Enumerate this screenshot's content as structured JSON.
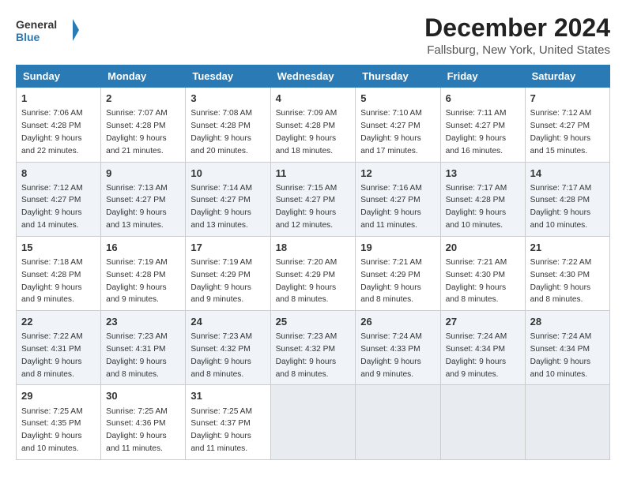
{
  "header": {
    "logo_general": "General",
    "logo_blue": "Blue",
    "month_title": "December 2024",
    "location": "Fallsburg, New York, United States"
  },
  "days_of_week": [
    "Sunday",
    "Monday",
    "Tuesday",
    "Wednesday",
    "Thursday",
    "Friday",
    "Saturday"
  ],
  "weeks": [
    [
      {
        "day": "1",
        "sunrise": "7:06 AM",
        "sunset": "4:28 PM",
        "daylight": "9 hours and 22 minutes."
      },
      {
        "day": "2",
        "sunrise": "7:07 AM",
        "sunset": "4:28 PM",
        "daylight": "9 hours and 21 minutes."
      },
      {
        "day": "3",
        "sunrise": "7:08 AM",
        "sunset": "4:28 PM",
        "daylight": "9 hours and 20 minutes."
      },
      {
        "day": "4",
        "sunrise": "7:09 AM",
        "sunset": "4:28 PM",
        "daylight": "9 hours and 18 minutes."
      },
      {
        "day": "5",
        "sunrise": "7:10 AM",
        "sunset": "4:27 PM",
        "daylight": "9 hours and 17 minutes."
      },
      {
        "day": "6",
        "sunrise": "7:11 AM",
        "sunset": "4:27 PM",
        "daylight": "9 hours and 16 minutes."
      },
      {
        "day": "7",
        "sunrise": "7:12 AM",
        "sunset": "4:27 PM",
        "daylight": "9 hours and 15 minutes."
      }
    ],
    [
      {
        "day": "8",
        "sunrise": "7:12 AM",
        "sunset": "4:27 PM",
        "daylight": "9 hours and 14 minutes."
      },
      {
        "day": "9",
        "sunrise": "7:13 AM",
        "sunset": "4:27 PM",
        "daylight": "9 hours and 13 minutes."
      },
      {
        "day": "10",
        "sunrise": "7:14 AM",
        "sunset": "4:27 PM",
        "daylight": "9 hours and 13 minutes."
      },
      {
        "day": "11",
        "sunrise": "7:15 AM",
        "sunset": "4:27 PM",
        "daylight": "9 hours and 12 minutes."
      },
      {
        "day": "12",
        "sunrise": "7:16 AM",
        "sunset": "4:27 PM",
        "daylight": "9 hours and 11 minutes."
      },
      {
        "day": "13",
        "sunrise": "7:17 AM",
        "sunset": "4:28 PM",
        "daylight": "9 hours and 10 minutes."
      },
      {
        "day": "14",
        "sunrise": "7:17 AM",
        "sunset": "4:28 PM",
        "daylight": "9 hours and 10 minutes."
      }
    ],
    [
      {
        "day": "15",
        "sunrise": "7:18 AM",
        "sunset": "4:28 PM",
        "daylight": "9 hours and 9 minutes."
      },
      {
        "day": "16",
        "sunrise": "7:19 AM",
        "sunset": "4:28 PM",
        "daylight": "9 hours and 9 minutes."
      },
      {
        "day": "17",
        "sunrise": "7:19 AM",
        "sunset": "4:29 PM",
        "daylight": "9 hours and 9 minutes."
      },
      {
        "day": "18",
        "sunrise": "7:20 AM",
        "sunset": "4:29 PM",
        "daylight": "9 hours and 8 minutes."
      },
      {
        "day": "19",
        "sunrise": "7:21 AM",
        "sunset": "4:29 PM",
        "daylight": "9 hours and 8 minutes."
      },
      {
        "day": "20",
        "sunrise": "7:21 AM",
        "sunset": "4:30 PM",
        "daylight": "9 hours and 8 minutes."
      },
      {
        "day": "21",
        "sunrise": "7:22 AM",
        "sunset": "4:30 PM",
        "daylight": "9 hours and 8 minutes."
      }
    ],
    [
      {
        "day": "22",
        "sunrise": "7:22 AM",
        "sunset": "4:31 PM",
        "daylight": "9 hours and 8 minutes."
      },
      {
        "day": "23",
        "sunrise": "7:23 AM",
        "sunset": "4:31 PM",
        "daylight": "9 hours and 8 minutes."
      },
      {
        "day": "24",
        "sunrise": "7:23 AM",
        "sunset": "4:32 PM",
        "daylight": "9 hours and 8 minutes."
      },
      {
        "day": "25",
        "sunrise": "7:23 AM",
        "sunset": "4:32 PM",
        "daylight": "9 hours and 8 minutes."
      },
      {
        "day": "26",
        "sunrise": "7:24 AM",
        "sunset": "4:33 PM",
        "daylight": "9 hours and 9 minutes."
      },
      {
        "day": "27",
        "sunrise": "7:24 AM",
        "sunset": "4:34 PM",
        "daylight": "9 hours and 9 minutes."
      },
      {
        "day": "28",
        "sunrise": "7:24 AM",
        "sunset": "4:34 PM",
        "daylight": "9 hours and 10 minutes."
      }
    ],
    [
      {
        "day": "29",
        "sunrise": "7:25 AM",
        "sunset": "4:35 PM",
        "daylight": "9 hours and 10 minutes."
      },
      {
        "day": "30",
        "sunrise": "7:25 AM",
        "sunset": "4:36 PM",
        "daylight": "9 hours and 11 minutes."
      },
      {
        "day": "31",
        "sunrise": "7:25 AM",
        "sunset": "4:37 PM",
        "daylight": "9 hours and 11 minutes."
      },
      null,
      null,
      null,
      null
    ]
  ],
  "labels": {
    "sunrise": "Sunrise: ",
    "sunset": "Sunset: ",
    "daylight": "Daylight: "
  }
}
